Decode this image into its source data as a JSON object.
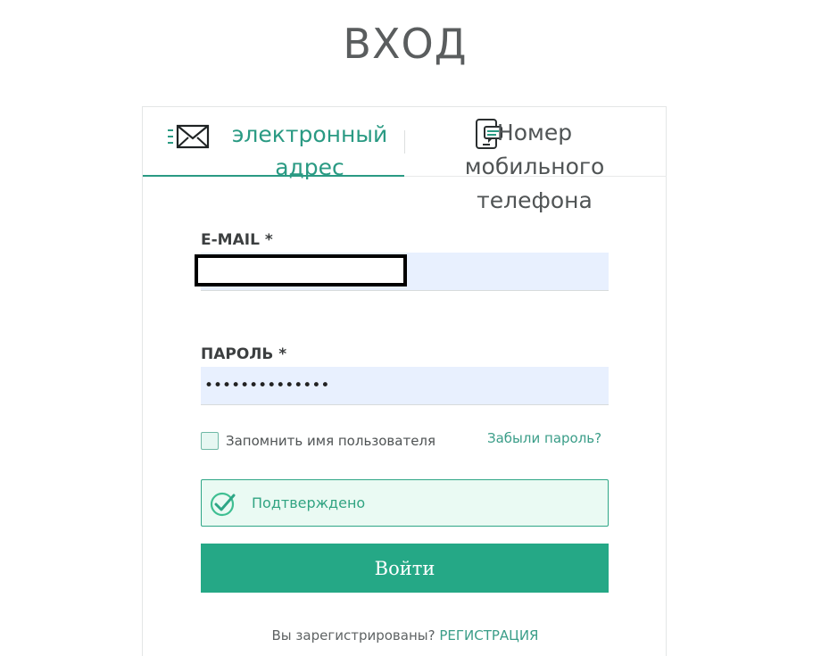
{
  "page": {
    "title": "ВХОД"
  },
  "tabs": {
    "email": {
      "label": "электронный адрес",
      "icon": "envelope-icon"
    },
    "phone": {
      "label": "Номер мобильного телефона",
      "icon": "phone-chat-icon"
    }
  },
  "form": {
    "email": {
      "label": "E-MAIL *",
      "value": ""
    },
    "password": {
      "label": "ПАРОЛЬ *",
      "value": "••••••••••••••"
    },
    "remember_label": "Запомнить имя пользователя",
    "forgot_label": "Забыли пароль?",
    "captcha_text": "Подтверждено",
    "submit_label": "Войти"
  },
  "footer": {
    "prompt": "Вы зарегистрированы?",
    "register_label": "РЕГИСТРАЦИЯ"
  },
  "colors": {
    "accent": "#25a886",
    "link": "#3a9d88",
    "input_bg": "#e8f0fe"
  }
}
